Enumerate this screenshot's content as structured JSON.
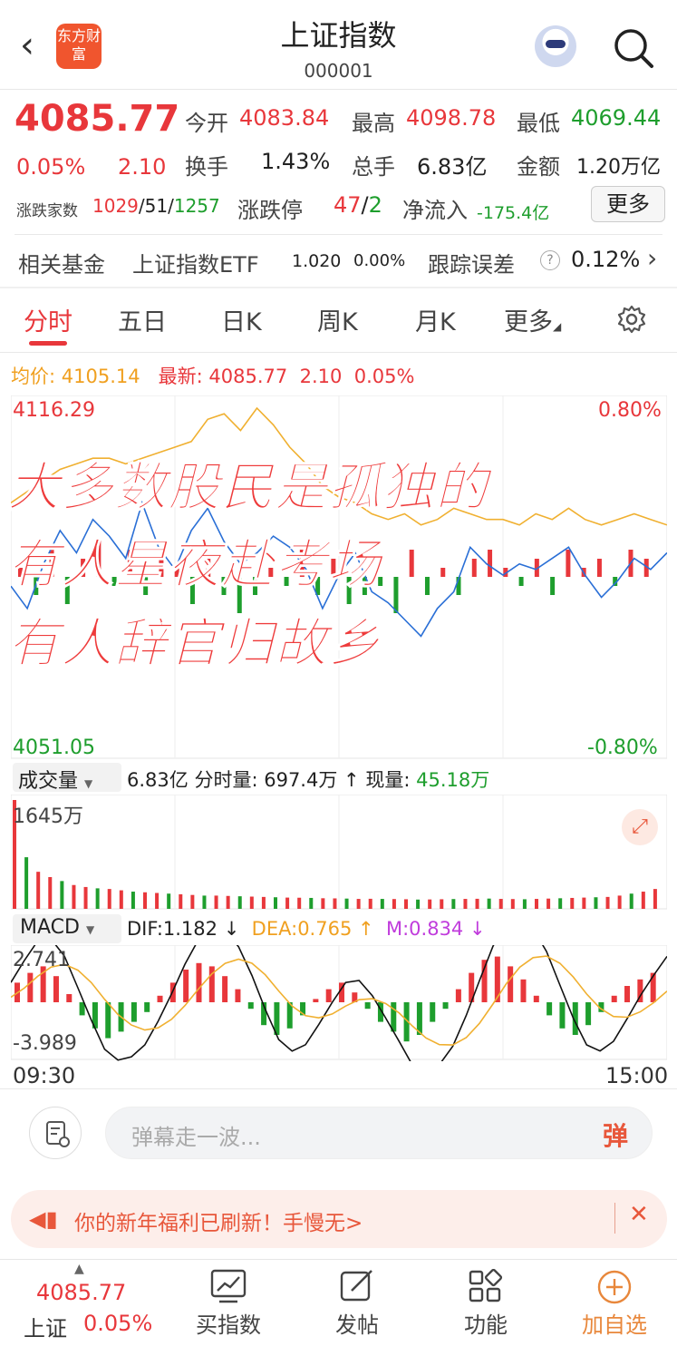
{
  "header": {
    "title": "上证指数",
    "code": "000001",
    "logo_text": "东方财富"
  },
  "quote": {
    "price": "4085.77",
    "change_pct": "0.05%",
    "change": "2.10",
    "open_label": "今开",
    "open": "4083.84",
    "high_label": "最高",
    "high": "4098.78",
    "low_label": "最低",
    "low": "4069.44",
    "turnover_label": "换手",
    "turnover": "1.43%",
    "volume_label": "总手",
    "volume": "6.83亿",
    "amount_label": "金额",
    "amount": "1.20万亿",
    "breadth_label": "涨跌家数",
    "up": "1029",
    "flat": "51",
    "down": "1257",
    "limit_label": "涨跌停",
    "limit_up": "47",
    "limit_down": "2",
    "netflow_label": "净流入",
    "netflow": "-175.4亿",
    "more_label": "更多"
  },
  "fund": {
    "label": "相关基金",
    "name": "上证指数ETF",
    "price": "1.020",
    "pct": "0.00%",
    "error_label": "跟踪误差",
    "error": "0.12%"
  },
  "tabs": [
    "分时",
    "五日",
    "日K",
    "周K",
    "月K",
    "更多"
  ],
  "chart_data": {
    "type": "line",
    "title": "",
    "avg_label": "均价:",
    "avg_price": "4105.14",
    "latest_label": "最新:",
    "latest": "4085.77",
    "latest_change": "2.10",
    "latest_pct": "0.05%",
    "ylim": [
      4051.05,
      4116.29
    ],
    "y_top": "4116.29",
    "y_bottom": "4051.05",
    "pct_top": "0.80%",
    "pct_bottom": "-0.80%",
    "x_start": "09:30",
    "x_end": "15:00",
    "series": [
      {
        "name": "price",
        "color": "#2a6fd6",
        "values": [
          4082,
          4078,
          4086,
          4092,
          4088,
          4094,
          4091,
          4087,
          4097,
          4089,
          4085,
          4092,
          4096,
          4090,
          4086,
          4088,
          4091,
          4089,
          4085,
          4078,
          4084,
          4088,
          4081,
          4079,
          4076,
          4073,
          4078,
          4081,
          4089,
          4086,
          4084,
          4086,
          4085,
          4087,
          4089,
          4084,
          4080,
          4083,
          4087,
          4085,
          4088
        ]
      },
      {
        "name": "avg",
        "color": "#f0a020",
        "values": [
          4097,
          4099,
          4101,
          4103,
          4104,
          4105,
          4105,
          4104,
          4105,
          4106,
          4107,
          4108,
          4112,
          4113,
          4110,
          4114,
          4111,
          4107,
          4104,
          4100,
          4098,
          4097,
          4095,
          4094,
          4095,
          4093,
          4094,
          4096,
          4095,
          4094,
          4094,
          4093,
          4095,
          4094,
          4096,
          4094,
          4093,
          4094,
          4095,
          4094,
          4093
        ]
      }
    ],
    "flow_bars": [
      1,
      -2,
      3,
      -3,
      2,
      4,
      -1,
      3,
      -2,
      2,
      1,
      -3,
      2,
      -2,
      -4,
      -2,
      1,
      -1,
      3,
      -2,
      2,
      -3,
      -2,
      -1,
      -4,
      3,
      -2,
      1,
      -2,
      2,
      3,
      1,
      -1,
      2,
      -2,
      3,
      1,
      2,
      -1,
      3,
      2
    ],
    "volume": {
      "label": "成交量",
      "total": "6.83亿",
      "minute_label": "分时量:",
      "minute": "697.4万",
      "arrow": "↑",
      "current_label": "现量:",
      "current": "45.18万",
      "max_label": "1645万",
      "values": [
        1645,
        780,
        560,
        480,
        420,
        360,
        330,
        310,
        300,
        280,
        260,
        250,
        240,
        230,
        220,
        210,
        200,
        200,
        195,
        190,
        185,
        180,
        175,
        170,
        168,
        165,
        160,
        158,
        155,
        150,
        152,
        150,
        148,
        145,
        140,
        142,
        145,
        148,
        150,
        152,
        155,
        150,
        148,
        145,
        150,
        155,
        160,
        165,
        170,
        175,
        180,
        200,
        230,
        260,
        300
      ]
    },
    "macd": {
      "label": "MACD",
      "dif_label": "DIF:",
      "dif": "1.182",
      "dif_arrow": "↓",
      "dea_label": "DEA:",
      "dea": "0.765",
      "dea_arrow": "↑",
      "m_label": "M:",
      "m": "0.834",
      "m_arrow": "↓",
      "y_top": "2.741",
      "y_bottom": "-3.989",
      "hist": [
        1.2,
        1.8,
        2.2,
        1.6,
        0.5,
        -0.8,
        -1.6,
        -2.2,
        -1.8,
        -1.2,
        -0.6,
        0.4,
        1.2,
        2.0,
        2.4,
        2.2,
        1.6,
        0.8,
        -0.4,
        -1.4,
        -2.0,
        -1.6,
        -0.8,
        0.2,
        0.8,
        1.2,
        0.6,
        -0.4,
        -1.2,
        -1.8,
        -2.4,
        -2.0,
        -1.2,
        -0.4,
        0.8,
        1.8,
        2.6,
        2.8,
        2.2,
        1.4,
        0.4,
        -0.8,
        -1.6,
        -2.0,
        -1.4,
        -0.6,
        0.4,
        1.0,
        1.4,
        1.8
      ]
    }
  },
  "overlay": {
    "line1": "大多数股民是孤独的",
    "line2": "有人星夜赴考场",
    "line3": "有人辞官归故乡"
  },
  "danmu": {
    "placeholder": "弹幕走一波...",
    "badge": "弹"
  },
  "banner": {
    "text": "你的新年福利已刷新！手慢无>"
  },
  "bottom_nav": {
    "index_price": "4085.77",
    "index_name": "上证",
    "index_pct": "0.05%",
    "items": [
      "买指数",
      "发帖",
      "功能",
      "加自选"
    ]
  }
}
